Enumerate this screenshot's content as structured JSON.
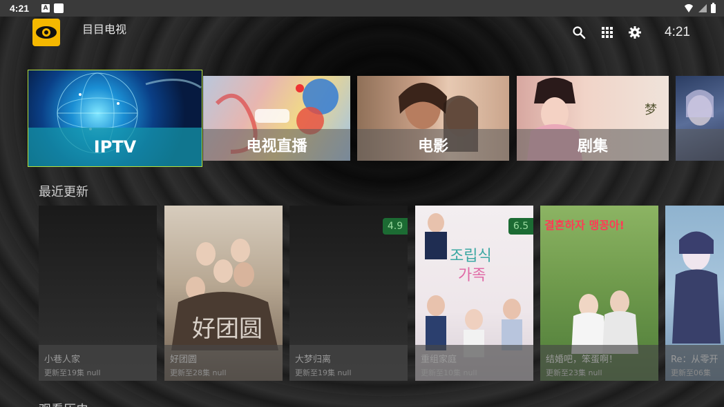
{
  "status_bar": {
    "time": "4:21",
    "notification_letter": "A"
  },
  "header": {
    "app_title": "目目电视",
    "clock": "4:21",
    "icons": [
      "search-icon",
      "apps-grid-icon",
      "settings-gear-icon"
    ]
  },
  "categories": [
    {
      "label": "IPTV"
    },
    {
      "label": "电视直播"
    },
    {
      "label": "电影"
    },
    {
      "label": "剧集"
    },
    {
      "label": ""
    }
  ],
  "recent": {
    "section_title": "最近更新",
    "items": [
      {
        "title": "小巷人家",
        "subtitle": "更新至19集 null",
        "rating": ""
      },
      {
        "title": "好团圆",
        "subtitle": "更新至28集 null",
        "rating": ""
      },
      {
        "title": "大梦归离",
        "subtitle": "更新至19集 null",
        "rating": "4.9"
      },
      {
        "title": "重组家庭",
        "subtitle": "更新至10集 null",
        "rating": "6.5"
      },
      {
        "title": "结婚吧，笨蛋啊！",
        "subtitle": "更新至23集 null",
        "rating": ""
      },
      {
        "title": "Re：从零开始的",
        "subtitle": "更新至06集",
        "rating": ""
      }
    ]
  },
  "history": {
    "section_title": "观看历史"
  },
  "colors": {
    "focus_border": "#b7e33c",
    "focus_label_bg": "#1496aa",
    "rating_bg": "#1c6b33",
    "logo_bg": "#f5b800"
  }
}
